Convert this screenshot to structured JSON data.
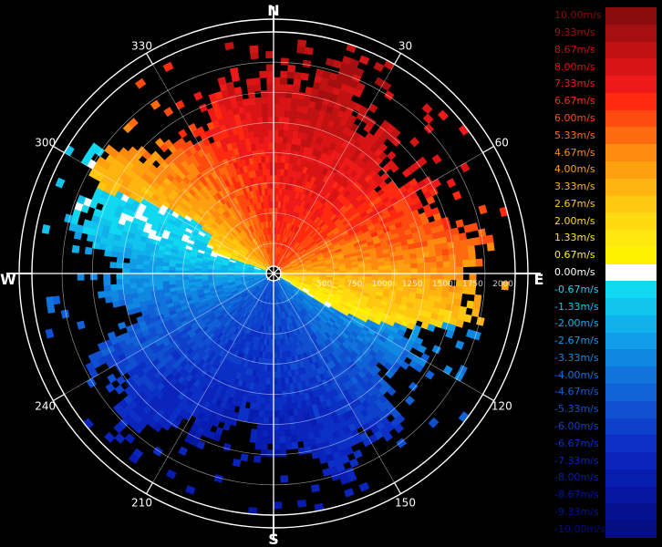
{
  "chart_data": {
    "type": "polar-radar",
    "compass": {
      "north": "N",
      "east": "E",
      "south": "S",
      "west": "W"
    },
    "bearing_labels": [
      "30",
      "60",
      "120",
      "150",
      "210",
      "240",
      "300",
      "330"
    ],
    "range_labels": [
      "500",
      "750",
      "1000",
      "1250",
      "1500",
      "1750",
      "2000"
    ],
    "range_max": 2000,
    "legend": [
      {
        "label": "10.00m/s",
        "color": "#8a0c0c"
      },
      {
        "label": "9.33m/s",
        "color": "#a50f0f"
      },
      {
        "label": "8.67m/s",
        "color": "#c01212"
      },
      {
        "label": "8.00m/s",
        "color": "#d81414"
      },
      {
        "label": "7.33m/s",
        "color": "#ee1a1a"
      },
      {
        "label": "6.67m/s",
        "color": "#ff2a10"
      },
      {
        "label": "6.00m/s",
        "color": "#ff4a10"
      },
      {
        "label": "5.33m/s",
        "color": "#ff6a10"
      },
      {
        "label": "4.67m/s",
        "color": "#ff8a10"
      },
      {
        "label": "4.00m/s",
        "color": "#ffa010"
      },
      {
        "label": "3.33m/s",
        "color": "#ffb410"
      },
      {
        "label": "2.67m/s",
        "color": "#ffc810"
      },
      {
        "label": "2.00m/s",
        "color": "#ffda10"
      },
      {
        "label": "1.33m/s",
        "color": "#ffe810"
      },
      {
        "label": "0.67m/s",
        "color": "#fff200"
      },
      {
        "label": "0.00m/s",
        "color": "#ffffff"
      },
      {
        "label": "-0.67m/s",
        "color": "#10d8f0"
      },
      {
        "label": "-1.33m/s",
        "color": "#10c4ee"
      },
      {
        "label": "-2.00m/s",
        "color": "#10b0ea"
      },
      {
        "label": "-2.67m/s",
        "color": "#109ce6"
      },
      {
        "label": "-3.33m/s",
        "color": "#1088e2"
      },
      {
        "label": "-4.00m/s",
        "color": "#1074dc"
      },
      {
        "label": "-4.67m/s",
        "color": "#1062d6"
      },
      {
        "label": "-5.33m/s",
        "color": "#1050d0"
      },
      {
        "label": "-6.00m/s",
        "color": "#0e40cc"
      },
      {
        "label": "-6.67m/s",
        "color": "#0c30c6"
      },
      {
        "label": "-7.33m/s",
        "color": "#0a24bc"
      },
      {
        "label": "-8.00m/s",
        "color": "#081cb0"
      },
      {
        "label": "-8.67m/s",
        "color": "#0616a0"
      },
      {
        "label": "-9.33m/s",
        "color": "#051290"
      },
      {
        "label": "-10.00m/s",
        "color": "#040e80"
      }
    ],
    "velocity_field": {
      "positive_sector": {
        "from_bearing": 305,
        "to_bearing": 115,
        "peak_value": 8.0,
        "peak_bearing": 20
      },
      "negative_sector": {
        "from_bearing": 115,
        "to_bearing": 305,
        "peak_value": -7.3,
        "peak_bearing": 190
      }
    }
  }
}
